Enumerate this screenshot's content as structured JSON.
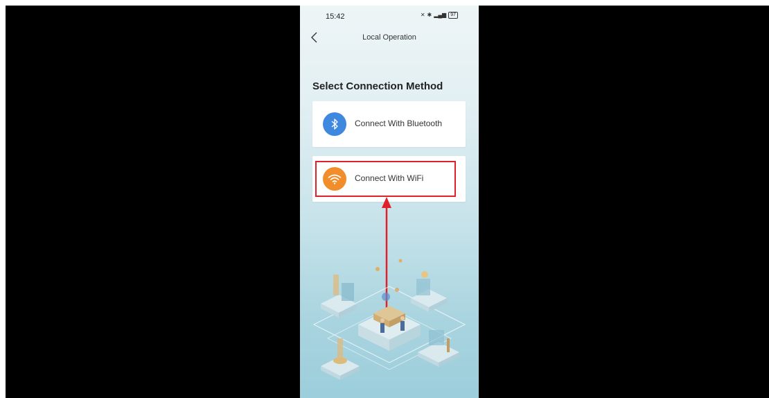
{
  "status_bar": {
    "time": "15:42",
    "battery": "97"
  },
  "header": {
    "title": "Local Operation"
  },
  "main": {
    "section_title": "Select Connection Method",
    "options": [
      {
        "label": "Connect With Bluetooth",
        "icon": "bluetooth-icon",
        "color": "#3f88e0"
      },
      {
        "label": "Connect With WiFi",
        "icon": "wifi-icon",
        "color": "#f28d2b"
      }
    ]
  },
  "annotation": {
    "highlight_color": "#e0202a",
    "target": "Connect With WiFi"
  }
}
